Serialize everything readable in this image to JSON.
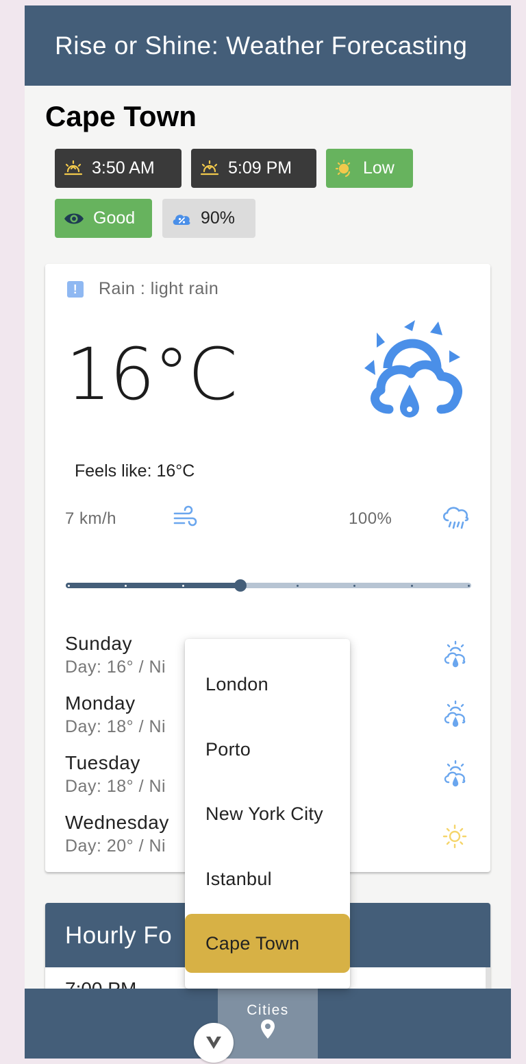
{
  "header": {
    "title": "Rise or Shine: Weather Forecasting"
  },
  "city": {
    "name": "Cape Town"
  },
  "chips": {
    "sunrise": "3:50 AM",
    "sunset": "5:09 PM",
    "uv": "Low",
    "visibility": "Good",
    "cloud_cover": "90%"
  },
  "current": {
    "alert": "Rain : light rain",
    "temperature": "16°C",
    "feels_like": "Feels like: 16°C",
    "wind": "7 km/h",
    "precipitation": "100%",
    "slider_fraction": 0.43
  },
  "forecast": [
    {
      "day": "Sunday",
      "temps": "Day: 16° / Ni",
      "icon": "sun-rain-icon"
    },
    {
      "day": "Monday",
      "temps": "Day: 18° / Ni",
      "icon": "sun-rain-icon"
    },
    {
      "day": "Tuesday",
      "temps": "Day: 18° / Ni",
      "icon": "sun-rain-icon"
    },
    {
      "day": "Wednesday",
      "temps": "Day: 20° / Ni",
      "icon": "sun-icon"
    }
  ],
  "hourly": {
    "title": "Hourly Fo",
    "first_time": "7:00 PM"
  },
  "nav": {
    "cities_label": "Cities"
  },
  "city_menu": {
    "items": [
      "London",
      "Porto",
      "New York City",
      "Istanbul",
      "Cape Town"
    ],
    "selected": "Cape Town"
  },
  "colors": {
    "primary": "#445e79",
    "accent": "#d7b145",
    "green": "#67b35e",
    "icon_blue": "#4a8fe8",
    "sun_yellow": "#f2c94c"
  }
}
